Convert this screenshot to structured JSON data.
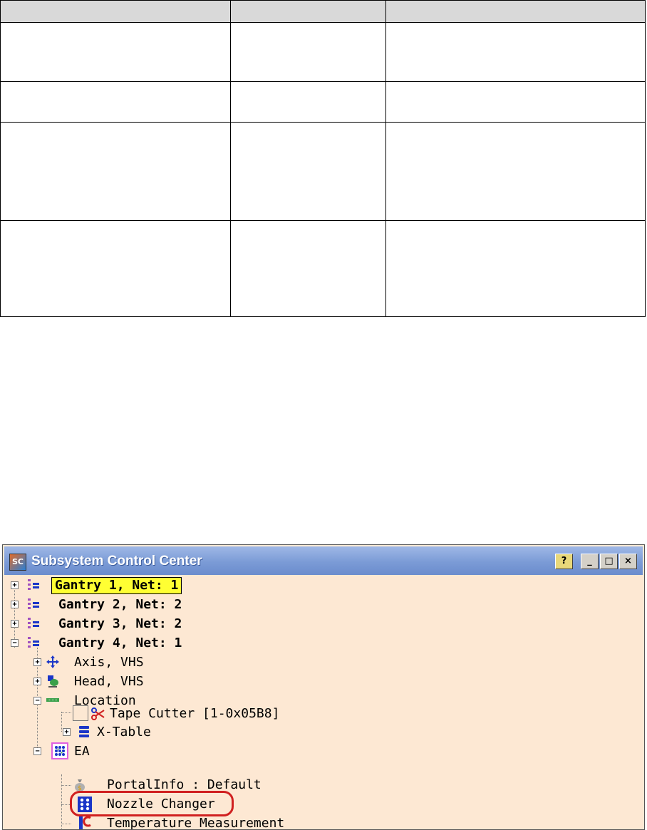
{
  "table": {
    "header": [
      "",
      "",
      ""
    ],
    "rows": [
      [
        "",
        "",
        ""
      ],
      [
        "",
        "",
        ""
      ],
      [
        "",
        "",
        ""
      ],
      [
        "",
        "",
        ""
      ]
    ]
  },
  "window": {
    "title": "Subsystem Control Center",
    "icon_text": "SC",
    "buttons": {
      "help": "?",
      "minimize": "_",
      "maximize": "□",
      "close": "×"
    },
    "tree": {
      "gantry1": "Gantry 1, Net: 1",
      "gantry2": "Gantry 2, Net: 2",
      "gantry3": "Gantry 3, Net: 2",
      "gantry4": "Gantry 4, Net: 1",
      "axis": "Axis, VHS",
      "head": "Head, VHS",
      "location": "Location",
      "tape_cutter": "Tape Cutter [1-0x05B8]",
      "xtable": "X-Table",
      "ea": "EA",
      "portalinfo": "PortalInfo : Default",
      "nozzle_changer": "Nozzle Changer",
      "temperature": "Temperature Measurement"
    },
    "colors": {
      "background": "#fde8d3",
      "highlight": "#ffff33",
      "annotation": "#d02020",
      "icon_blue": "#1a35c8"
    }
  }
}
